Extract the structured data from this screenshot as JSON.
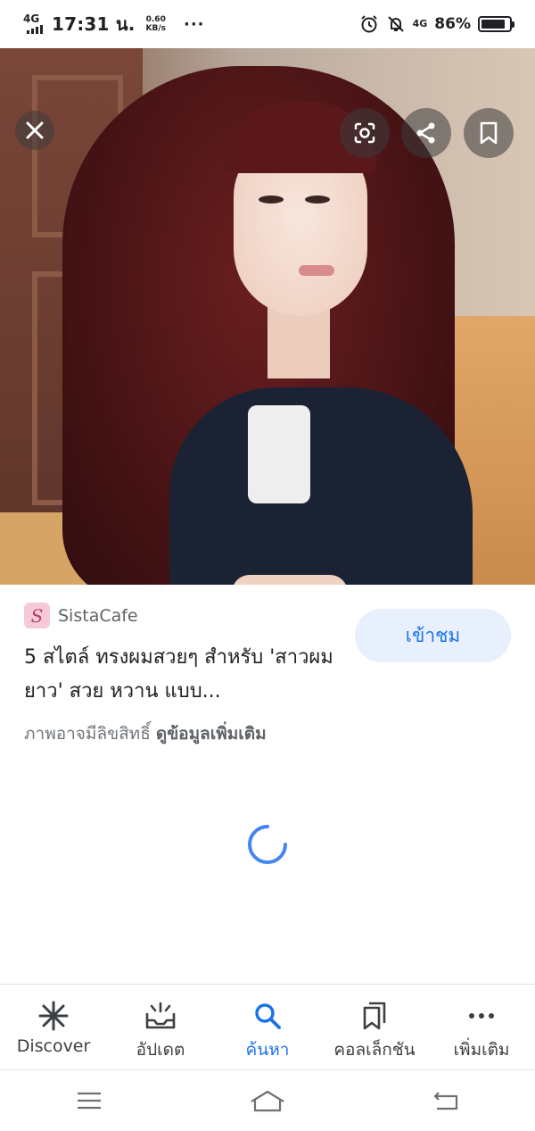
{
  "status_bar": {
    "network": "4G",
    "time": "17:31 น.",
    "speed_value": "0.60",
    "speed_unit": "KB/s",
    "more": "···",
    "net_right": "4G",
    "battery_percent": "86%",
    "battery_level": 0.86
  },
  "image_viewer": {
    "close_icon": "close-icon",
    "lens_icon": "google-lens-icon",
    "share_icon": "share-icon",
    "save_icon": "bookmark-icon"
  },
  "result": {
    "source_logo_letter": "S",
    "source_name": "SistaCafe",
    "title": "5 สไตล์ ทรงผมสวยๆ สำหรับ 'สาวผมยาว' สวย หวาน แบบ...",
    "visit_label": "เข้าชม",
    "copyright_text": "ภาพอาจมีลิขสิทธิ์",
    "more_info_link": "ดูข้อมูลเพิ่มเติม"
  },
  "bottom_nav": {
    "items": [
      {
        "label": "Discover",
        "icon": "asterisk-icon",
        "active": false
      },
      {
        "label": "อัปเดต",
        "icon": "updates-icon",
        "active": false
      },
      {
        "label": "ค้นหา",
        "icon": "search-icon",
        "active": true
      },
      {
        "label": "คอลเล็กชัน",
        "icon": "collections-icon",
        "active": false
      },
      {
        "label": "เพิ่มเติม",
        "icon": "more-dots-icon",
        "active": false
      }
    ]
  },
  "colors": {
    "accent": "#1a73e8",
    "visit_bg": "#e8f0fe",
    "text_primary": "#202124",
    "text_secondary": "#70757a"
  }
}
